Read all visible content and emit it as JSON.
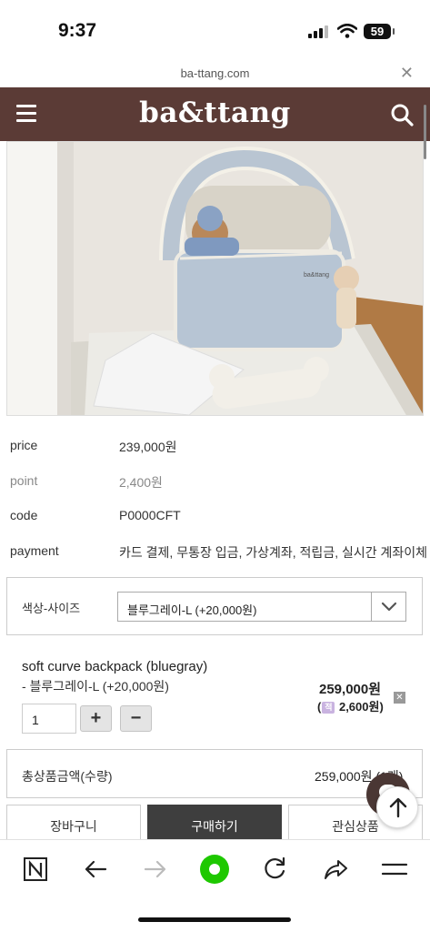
{
  "status_bar": {
    "time": "9:37",
    "battery": "59"
  },
  "browser": {
    "url": "ba-ttang.com"
  },
  "header": {
    "logo": "ba&ttang"
  },
  "product": {
    "image_alt": "product photo",
    "info": [
      {
        "label": "price",
        "value": "239,000원"
      },
      {
        "label": "point",
        "value": "2,400원"
      },
      {
        "label": "code",
        "value": "P0000CFT"
      },
      {
        "label": "payment",
        "value": "카드 결제, 무통장 입금, 가상계좌, 적립금, 실시간 계좌이체"
      }
    ],
    "option": {
      "label": "색상-사이즈",
      "selected": "블루그레이-L (+20,000원)"
    }
  },
  "selected_item": {
    "name": "soft curve backpack (bluegray)",
    "option": "- 블루그레이-L (+20,000원)",
    "price": "259,000원",
    "point_open": "(",
    "point_badge": "적",
    "point_value": "2,600원)",
    "quantity": "1",
    "plus": "+",
    "minus": "−",
    "remove": "✕"
  },
  "total": {
    "label": "총상품금액(수량)",
    "value": "259,000원 (1개)"
  },
  "actions": {
    "cart": "장바구니",
    "buy": "구매하기",
    "wishlist": "관심상품"
  },
  "colors": {
    "header_bg": "#5b3b36",
    "buy_bg": "#3e3e3e",
    "nav_green": "#1ec800"
  },
  "icons": [
    "hamburger-menu-icon",
    "search-icon",
    "close-icon",
    "chevron-down-icon",
    "chat-icon",
    "arrow-up-icon",
    "naver-n-icon",
    "back-arrow-icon",
    "forward-arrow-icon",
    "green-home-icon",
    "refresh-icon",
    "share-icon",
    "menu-icon"
  ]
}
